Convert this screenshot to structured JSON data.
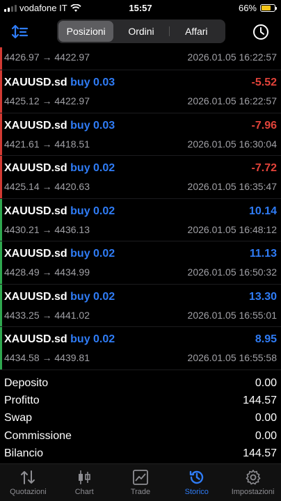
{
  "status_bar": {
    "carrier": "vodafone IT",
    "time": "15:57",
    "battery": "66%"
  },
  "nav": {
    "segments": [
      "Posizioni",
      "Ordini",
      "Affari"
    ],
    "active_segment": "Posizioni"
  },
  "first_row": {
    "prices": "4426.97 → 4422.97",
    "time": "2026.01.05 16:22:57",
    "side_color": "#e2433a"
  },
  "trades": [
    {
      "symbol": "XAUUSD.sd",
      "side": "buy 0.03",
      "profit": "-5.52",
      "prices": "4425.12 → 4422.97",
      "time": "2026.01.05 16:22:57",
      "profit_color": "#e2433a"
    },
    {
      "symbol": "XAUUSD.sd",
      "side": "buy 0.03",
      "profit": "-7.96",
      "prices": "4421.61 → 4418.51",
      "time": "2026.01.05 16:30:04",
      "profit_color": "#e2433a"
    },
    {
      "symbol": "XAUUSD.sd",
      "side": "buy 0.02",
      "profit": "-7.72",
      "prices": "4425.14 → 4420.63",
      "time": "2026.01.05 16:35:47",
      "profit_color": "#e2433a"
    },
    {
      "symbol": "XAUUSD.sd",
      "side": "buy 0.02",
      "profit": "10.14",
      "prices": "4430.21 → 4436.13",
      "time": "2026.01.05 16:48:12",
      "profit_color": "#2f7cf6"
    },
    {
      "symbol": "XAUUSD.sd",
      "side": "buy 0.02",
      "profit": "11.13",
      "prices": "4428.49 → 4434.99",
      "time": "2026.01.05 16:50:32",
      "profit_color": "#2f7cf6"
    },
    {
      "symbol": "XAUUSD.sd",
      "side": "buy 0.02",
      "profit": "13.30",
      "prices": "4433.25 → 4441.02",
      "time": "2026.01.05 16:55:01",
      "profit_color": "#2f7cf6"
    },
    {
      "symbol": "XAUUSD.sd",
      "side": "buy 0.02",
      "profit": "8.95",
      "prices": "4434.58 → 4439.81",
      "time": "2026.01.05 16:55:58",
      "profit_color": "#2f7cf6"
    }
  ],
  "summary": [
    {
      "label": "Deposito",
      "value": "0.00"
    },
    {
      "label": "Profitto",
      "value": "144.57"
    },
    {
      "label": "Swap",
      "value": "0.00"
    },
    {
      "label": "Commissione",
      "value": "0.00"
    },
    {
      "label": "Bilancio",
      "value": "144.57"
    }
  ],
  "tabbar": [
    {
      "label": "Quotazioni",
      "icon": "quotes-arrows-icon",
      "active": false
    },
    {
      "label": "Chart",
      "icon": "candlestick-icon",
      "active": false
    },
    {
      "label": "Trade",
      "icon": "trade-chart-icon",
      "active": false
    },
    {
      "label": "Storico",
      "icon": "history-clock-icon",
      "active": true
    },
    {
      "label": "Impostazioni",
      "icon": "gear-icon",
      "active": false
    }
  ],
  "colors": {
    "loss": "#e2433a",
    "gain": "#2f7cf6",
    "bar_red": "#d23a33",
    "bar_green": "#2fa84f"
  }
}
